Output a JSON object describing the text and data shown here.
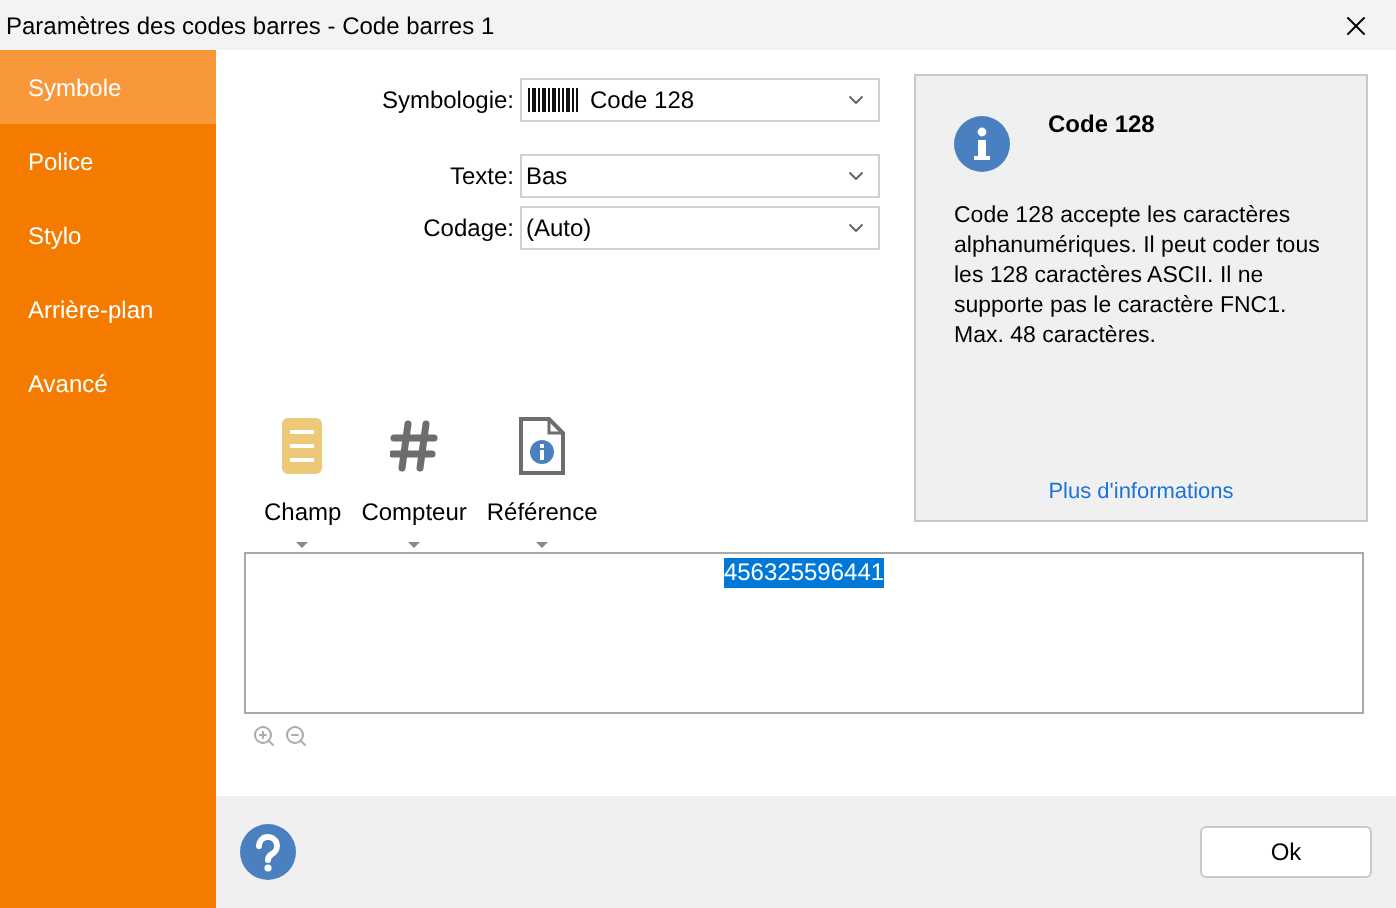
{
  "window": {
    "title": "Paramètres des codes barres - Code barres 1"
  },
  "sidebar": {
    "items": [
      {
        "label": "Symbole",
        "selected": true
      },
      {
        "label": "Police",
        "selected": false
      },
      {
        "label": "Stylo",
        "selected": false
      },
      {
        "label": "Arrière-plan",
        "selected": false
      },
      {
        "label": "Avancé",
        "selected": false
      }
    ]
  },
  "form": [
    {
      "label": "Symbologie:",
      "value": "Code 128",
      "kind": "barcode"
    },
    {
      "label": "Texte:",
      "value": "Bas",
      "kind": "plain"
    },
    {
      "label": "Codage:",
      "value": "(Auto)",
      "kind": "plain"
    }
  ],
  "info": {
    "title": "Code 128",
    "description": "Code 128 accepte les caractères alphanumériques. Il peut coder tous les 128 caractères ASCII. Il ne supporte pas le caractère FNC1. Max. 48 caractères.",
    "link": "Plus d'informations"
  },
  "toolbar": [
    {
      "label": "Champ",
      "kind": "field"
    },
    {
      "label": "Compteur",
      "kind": "counter"
    },
    {
      "label": "Référence",
      "kind": "reference"
    }
  ],
  "editor": {
    "value": "456325596441",
    "selected": true
  },
  "buttons": {
    "ok": "Ok"
  }
}
